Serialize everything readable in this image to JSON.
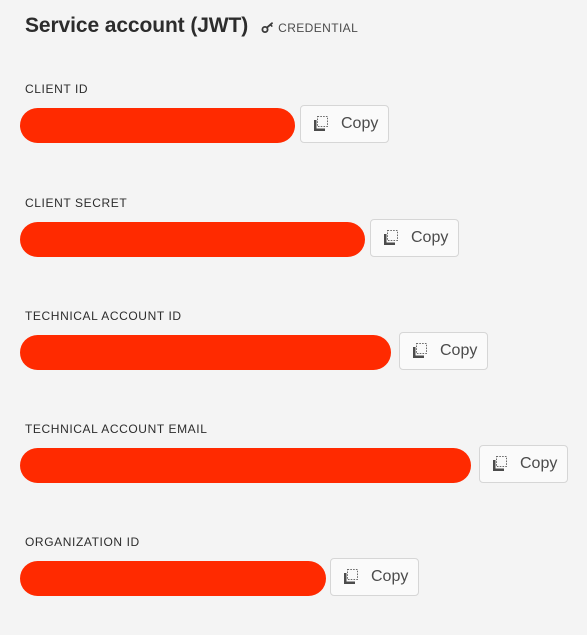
{
  "header": {
    "title": "Service account (JWT)",
    "badge_label": "CREDENTIAL",
    "badge_icon": "key-icon"
  },
  "fields": [
    {
      "label": "CLIENT ID",
      "value_state": "redacted",
      "copy_label": "Copy",
      "copy_icon": "copy-icon"
    },
    {
      "label": "CLIENT SECRET",
      "value_state": "redacted",
      "copy_label": "Copy",
      "copy_icon": "copy-icon"
    },
    {
      "label": "TECHNICAL ACCOUNT ID",
      "value_state": "redacted",
      "copy_label": "Copy",
      "copy_icon": "copy-icon"
    },
    {
      "label": "TECHNICAL ACCOUNT EMAIL",
      "value_state": "redacted",
      "copy_label": "Copy",
      "copy_icon": "copy-icon"
    },
    {
      "label": "ORGANIZATION ID",
      "value_state": "redacted",
      "copy_label": "Copy",
      "copy_icon": "copy-icon"
    }
  ],
  "colors": {
    "background": "#f4f4f4",
    "redaction": "#ff2a00",
    "text": "#2c2c2c",
    "button_background": "#fafafa",
    "button_border": "#d6d6d6"
  }
}
